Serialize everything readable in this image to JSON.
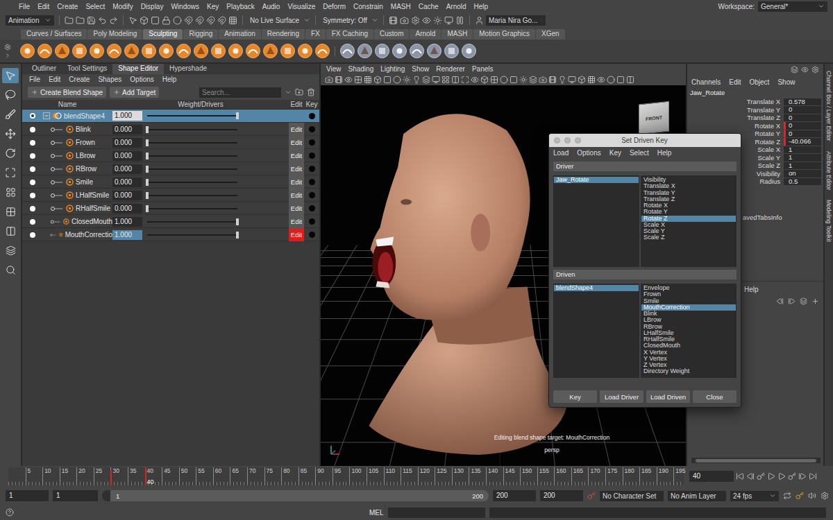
{
  "menu_bar": {
    "items": [
      "File",
      "Edit",
      "Create",
      "Select",
      "Modify",
      "Display",
      "Windows",
      "Key",
      "Playback",
      "Audio",
      "Visualize",
      "Deform",
      "Constrain",
      "MASH",
      "Cache",
      "Arnold",
      "Help"
    ],
    "workspace_label": "Workspace:",
    "workspace": "General*"
  },
  "status_line": {
    "mode": "Animation",
    "live_surface": "No Live Surface",
    "symmetry": "Symmetry: Off",
    "user": "Maria Nira Go..."
  },
  "shelf": {
    "tabs": [
      {
        "label": "Curves / Surfaces",
        "selected": false
      },
      {
        "label": "Poly Modeling",
        "selected": false
      },
      {
        "label": "Sculpting",
        "selected": true
      },
      {
        "label": "Rigging",
        "selected": false
      },
      {
        "label": "Animation",
        "selected": false
      },
      {
        "label": "Rendering",
        "selected": false
      },
      {
        "label": "FX",
        "selected": false
      },
      {
        "label": "FX Caching",
        "selected": false
      },
      {
        "label": "Custom",
        "selected": false
      },
      {
        "label": "Arnold",
        "selected": false
      },
      {
        "label": "MASH",
        "selected": false
      },
      {
        "label": "Motion Graphics",
        "selected": false
      },
      {
        "label": "XGen",
        "selected": false
      }
    ]
  },
  "panel_tabs": [
    {
      "label": "Outliner",
      "selected": false
    },
    {
      "label": "Tool Settings",
      "selected": false
    },
    {
      "label": "Shape Editor",
      "selected": true
    },
    {
      "label": "Hypershade",
      "selected": false
    }
  ],
  "shape_editor": {
    "menu": [
      "File",
      "Edit",
      "Create",
      "Shapes",
      "Options",
      "Help"
    ],
    "buttons": [
      "Create Blend Shape",
      "Add Target"
    ],
    "search": {
      "placeholder": "Search..."
    },
    "columns": [
      "Name",
      "Weight/Drivers",
      "Edit",
      "Key"
    ],
    "rows": [
      {
        "name": "blendShape4",
        "value": "1.000",
        "level": 1,
        "kind": "group",
        "selected": true,
        "expanded": true,
        "visible": true
      },
      {
        "name": "Blink",
        "value": "0.000",
        "level": 0,
        "kind": "target",
        "selected": false,
        "visible": true,
        "edit": "Edit",
        "editing": false,
        "field_selected": false
      },
      {
        "name": "Frown",
        "value": "0.000",
        "level": 0,
        "kind": "target",
        "selected": false,
        "visible": true,
        "edit": "Edit",
        "editing": false,
        "field_selected": false
      },
      {
        "name": "LBrow",
        "value": "0.000",
        "level": 0,
        "kind": "target",
        "selected": false,
        "visible": true,
        "edit": "Edit",
        "editing": false,
        "field_selected": false
      },
      {
        "name": "RBrow",
        "value": "0.000",
        "level": 0,
        "kind": "target",
        "selected": false,
        "visible": true,
        "edit": "Edit",
        "editing": false,
        "field_selected": false
      },
      {
        "name": "Smile",
        "value": "0.000",
        "level": 0,
        "kind": "target",
        "selected": false,
        "visible": true,
        "edit": "Edit",
        "editing": false,
        "field_selected": false
      },
      {
        "name": "LHalfSmile",
        "value": "0.000",
        "level": 0,
        "kind": "target",
        "selected": false,
        "visible": true,
        "edit": "Edit",
        "editing": false,
        "field_selected": false
      },
      {
        "name": "RHalfSmile",
        "value": "0.000",
        "level": 0,
        "kind": "target",
        "selected": false,
        "visible": true,
        "edit": "Edit",
        "editing": false,
        "field_selected": false
      },
      {
        "name": "ClosedMouth",
        "value": "1.000",
        "level": 1,
        "kind": "target",
        "selected": false,
        "visible": true,
        "edit": "Edit",
        "editing": false,
        "field_selected": false
      },
      {
        "name": "MouthCorrectio",
        "value": "1.000",
        "level": 1,
        "kind": "target",
        "selected": false,
        "visible": true,
        "edit": "Edit",
        "editing": true,
        "field_selected": true
      }
    ]
  },
  "viewport": {
    "menu": [
      "View",
      "Shading",
      "Lighting",
      "Show",
      "Renderer",
      "Panels"
    ],
    "view_cube": "FRONT",
    "message": "Editing blend shape target: MouthCorrection",
    "camera": "persp"
  },
  "channel_box": {
    "menu": [
      "Channels",
      "Edit",
      "Object",
      "Show"
    ],
    "object": "Jaw_Rotate",
    "attributes": [
      {
        "name": "Translate X",
        "value": "0.578",
        "keyed": false
      },
      {
        "name": "Translate Y",
        "value": "0",
        "keyed": false
      },
      {
        "name": "Translate Z",
        "value": "0",
        "keyed": false
      },
      {
        "name": "Rotate X",
        "value": "0",
        "keyed": true
      },
      {
        "name": "Rotate Y",
        "value": "0",
        "keyed": true
      },
      {
        "name": "Rotate Z",
        "value": "-40.066",
        "keyed": true
      },
      {
        "name": "Scale X",
        "value": "1",
        "keyed": false
      },
      {
        "name": "Scale Y",
        "value": "1",
        "keyed": false
      },
      {
        "name": "Scale Z",
        "value": "1",
        "keyed": false
      },
      {
        "name": "Visibility",
        "value": "on",
        "keyed": false
      },
      {
        "name": "Radius",
        "value": "0.5",
        "keyed": false
      }
    ],
    "saved_tabs": "avedTabsInfo",
    "layer_menu": [
      "Help"
    ]
  },
  "side_tabs": [
    "Channel Box / Layer Editor",
    "Attribute Editor",
    "Modeling Toolkit"
  ],
  "set_driven_key": {
    "title": "Set Driven Key",
    "menu": [
      "Load",
      "Options",
      "Key",
      "Select",
      "Help"
    ],
    "driver": {
      "label": "Driver",
      "objects": [
        {
          "name": "Jaw_Rotate",
          "selected": true
        }
      ],
      "attributes": [
        {
          "name": "Visibility",
          "selected": false
        },
        {
          "name": "Translate X",
          "selected": false
        },
        {
          "name": "Translate Y",
          "selected": false
        },
        {
          "name": "Translate Z",
          "selected": false
        },
        {
          "name": "Rotate X",
          "selected": false
        },
        {
          "name": "Rotate Y",
          "selected": false
        },
        {
          "name": "Rotate Z",
          "selected": true
        },
        {
          "name": "Scale X",
          "selected": false
        },
        {
          "name": "Scale Y",
          "selected": false
        },
        {
          "name": "Scale Z",
          "selected": false
        }
      ]
    },
    "driven": {
      "label": "Driven",
      "objects": [
        {
          "name": "blendShape4",
          "selected": true
        }
      ],
      "attributes": [
        {
          "name": "Envelope",
          "selected": false
        },
        {
          "name": "Frown",
          "selected": false
        },
        {
          "name": "Smile",
          "selected": false
        },
        {
          "name": "MouthCorrection",
          "selected": true
        },
        {
          "name": "Blink",
          "selected": false
        },
        {
          "name": "LBrow",
          "selected": false
        },
        {
          "name": "RBrow",
          "selected": false
        },
        {
          "name": "LHalfSmile",
          "selected": false
        },
        {
          "name": "RHalfSmile",
          "selected": false
        },
        {
          "name": "ClosedMouth",
          "selected": false
        },
        {
          "name": "X Vertex",
          "selected": false
        },
        {
          "name": "Y Vertex",
          "selected": false
        },
        {
          "name": "Z Vertex",
          "selected": false
        },
        {
          "name": "Directory Weight",
          "selected": false
        }
      ]
    },
    "buttons": [
      "Key",
      "Load Driver",
      "Load Driven",
      "Close"
    ]
  },
  "time_slider": {
    "ticks": [
      "5",
      "10",
      "15",
      "20",
      "25",
      "30",
      "35",
      "40",
      "45",
      "50",
      "55",
      "60",
      "65",
      "70",
      "75",
      "80",
      "85",
      "90",
      "95",
      "100",
      "105",
      "110",
      "115",
      "120",
      "125",
      "130",
      "135",
      "140",
      "145",
      "150",
      "155",
      "160",
      "165",
      "170",
      "175",
      "180",
      "185",
      "190",
      "195"
    ],
    "key_frames": [
      "30"
    ],
    "current": "40",
    "current_field": "40"
  },
  "range_slider": {
    "start": "1",
    "range_start": "1",
    "bar_start": "1",
    "bar_end": "200",
    "range_end": "200",
    "end": "200",
    "character_set": "No Character Set",
    "anim_layer": "No Anim Layer",
    "fps": "24 fps"
  },
  "command_line": {
    "language": "MEL"
  }
}
